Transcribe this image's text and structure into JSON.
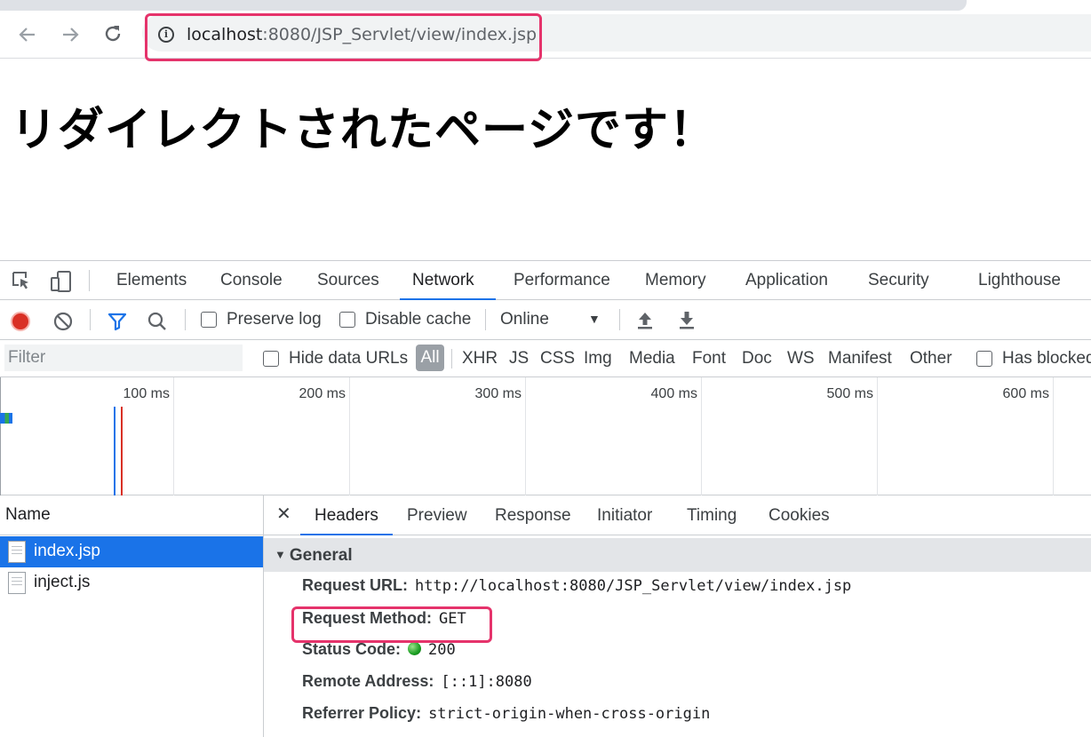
{
  "browser": {
    "back_icon": "arrow-left-icon",
    "forward_icon": "arrow-right-icon",
    "reload_icon": "reload-icon",
    "url_host": "localhost",
    "url_rest": ":8080/JSP_Servlet/view/index.jsp"
  },
  "page": {
    "heading": "リダイレクトされたページです！"
  },
  "devtools": {
    "tabs": [
      "Elements",
      "Console",
      "Sources",
      "Network",
      "Performance",
      "Memory",
      "Application",
      "Security",
      "Lighthouse"
    ],
    "active_tab": "Network",
    "network_toolbar": {
      "preserve_log": "Preserve log",
      "disable_cache": "Disable cache",
      "throttling": "Online"
    },
    "filter_bar": {
      "placeholder": "Filter",
      "hide_data_urls": "Hide data URLs",
      "all": "All",
      "types": [
        "XHR",
        "JS",
        "CSS",
        "Img",
        "Media",
        "Font",
        "Doc",
        "WS",
        "Manifest",
        "Other"
      ],
      "has_blocked": "Has blocked"
    },
    "timeline_ticks": [
      "100 ms",
      "200 ms",
      "300 ms",
      "400 ms",
      "500 ms",
      "600 ms"
    ],
    "requests": {
      "header": "Name",
      "items": [
        "index.jsp",
        "inject.js"
      ],
      "selected": "index.jsp"
    },
    "detail_tabs": [
      "Headers",
      "Preview",
      "Response",
      "Initiator",
      "Timing",
      "Cookies"
    ],
    "active_detail_tab": "Headers",
    "general": {
      "title": "General",
      "request_url_key": "Request URL:",
      "request_url_value": "http://localhost:8080/JSP_Servlet/view/index.jsp",
      "request_method_key": "Request Method:",
      "request_method_value": "GET",
      "status_code_key": "Status Code:",
      "status_code_value": "200",
      "remote_address_key": "Remote Address:",
      "remote_address_value": "[::1]:8080",
      "referrer_policy_key": "Referrer Policy:",
      "referrer_policy_value": "strict-origin-when-cross-origin"
    }
  },
  "colors": {
    "highlight": "#e5336b",
    "accent": "#1a73e8",
    "record": "#d93025"
  }
}
